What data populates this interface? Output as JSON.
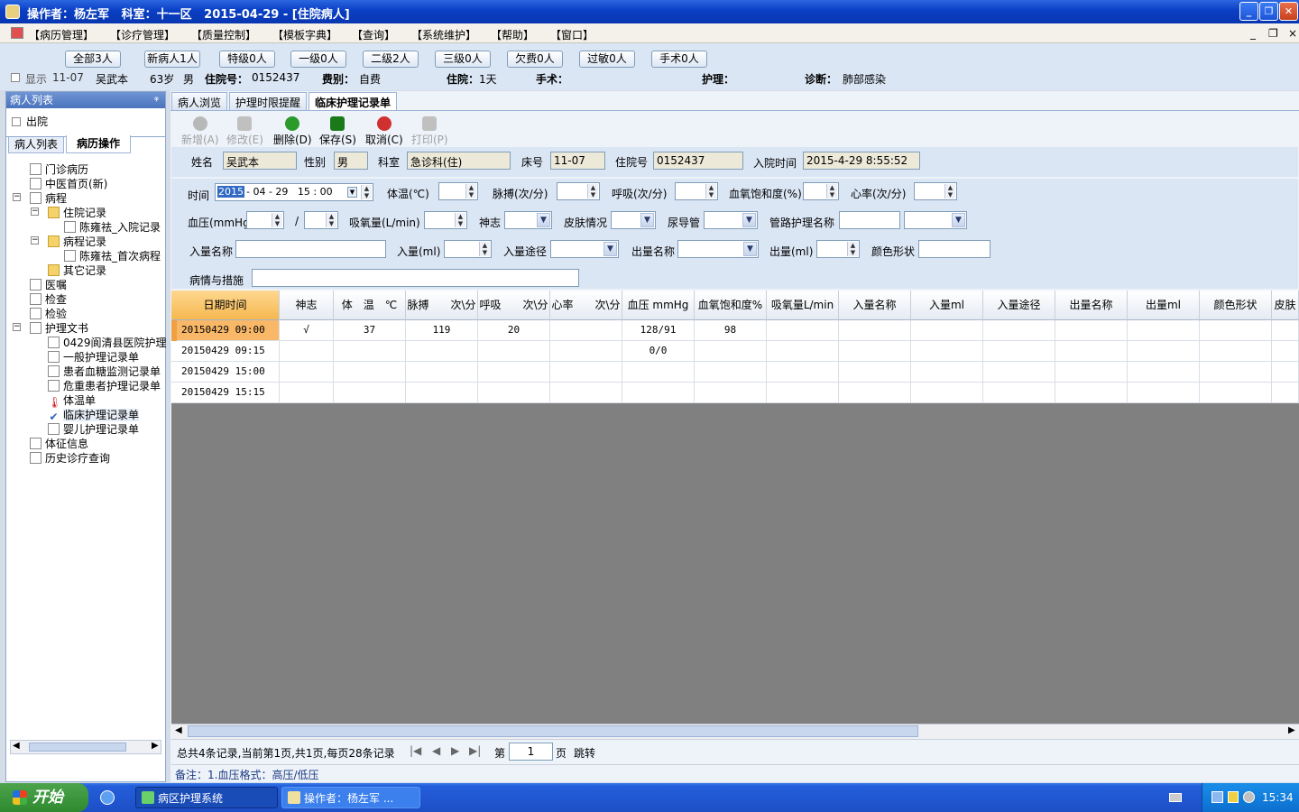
{
  "window": {
    "title": "操作者：杨左军   科室：十一区   2015-04-29 - [住院病人]",
    "btn_min": "_",
    "btn_max": "❐",
    "btn_close": "✕"
  },
  "menubar": {
    "items": [
      "【病历管理】",
      "【诊疗管理】",
      "【质量控制】",
      "【模板字典】",
      "【查询】",
      "【系统维护】",
      "【帮助】",
      "【窗口】"
    ],
    "right_controls": [
      "_",
      "❐",
      "×"
    ]
  },
  "filters": [
    "全部3人",
    "新病人1人",
    "特级0人",
    "一级0人",
    "二级2人",
    "三级0人",
    "欠费0人",
    "过敏0人",
    "手术0人"
  ],
  "patient_bar": {
    "show_label": "显示",
    "bed": "11-07",
    "name": "吴武本",
    "age": "63岁",
    "sex": "男",
    "admission_no_label": "住院号：",
    "admission_no": "0152437",
    "fee_label": "费别：",
    "fee": "自费",
    "stay_label": "住院：",
    "stay": "1天",
    "surgery_label": "手术：",
    "nursing_label": "护理：",
    "diagnosis_label": "诊断：",
    "diagnosis": "肺部感染"
  },
  "left_panel": {
    "header": "病人列表",
    "pin": "ᵠ",
    "discharged_label": "出院",
    "tabs": [
      "病人列表",
      "病历操作"
    ],
    "tree": [
      {
        "label": "门诊病历",
        "depth": 1,
        "icon": "document-icon"
      },
      {
        "label": "中医首页(新)",
        "depth": 1,
        "icon": "document-icon"
      },
      {
        "label": "病程",
        "depth": 1,
        "icon": "document-icon"
      },
      {
        "label": "住院记录",
        "depth": 2,
        "icon": "folder-icon"
      },
      {
        "label": "陈雍祛_入院记录",
        "depth": 3,
        "icon": "document-icon"
      },
      {
        "label": "病程记录",
        "depth": 2,
        "icon": "folder-icon"
      },
      {
        "label": "陈雍祛_首次病程",
        "depth": 3,
        "icon": "document-icon"
      },
      {
        "label": "其它记录",
        "depth": 2,
        "icon": "folder-icon"
      },
      {
        "label": "医嘱",
        "depth": 1,
        "icon": "document-icon"
      },
      {
        "label": "检查",
        "depth": 1,
        "icon": "document-icon"
      },
      {
        "label": "检验",
        "depth": 1,
        "icon": "document-icon"
      },
      {
        "label": "护理文书",
        "depth": 1,
        "icon": "document-icon"
      },
      {
        "label": "0429阆清县医院护理",
        "depth": 2,
        "icon": "document-icon"
      },
      {
        "label": "一般护理记录单",
        "depth": 2,
        "icon": "document-icon"
      },
      {
        "label": "患者血糖监测记录单",
        "depth": 2,
        "icon": "document-icon"
      },
      {
        "label": "危重患者护理记录单",
        "depth": 2,
        "icon": "document-icon"
      },
      {
        "label": "体温单",
        "depth": 2,
        "icon": "thermometer-icon"
      },
      {
        "label": "临床护理记录单",
        "depth": 2,
        "icon": "check-icon"
      },
      {
        "label": "婴儿护理记录单",
        "depth": 2,
        "icon": "document-icon"
      },
      {
        "label": "体征信息",
        "depth": 1,
        "icon": "document-icon"
      },
      {
        "label": "历史诊疗查询",
        "depth": 1,
        "icon": "document-icon"
      }
    ]
  },
  "main_tabs": [
    "病人浏览",
    "护理时限提醒",
    "临床护理记录单"
  ],
  "toolbar": {
    "add": "新增(A)",
    "edit": "修改(E)",
    "delete": "删除(D)",
    "save": "保存(S)",
    "cancel": "取消(C)",
    "print": "打印(P)"
  },
  "info": {
    "name_label": "姓名",
    "name": "吴武本",
    "sex_label": "性别",
    "sex": "男",
    "dept_label": "科室",
    "dept": "急诊科(住)",
    "bed_label": "床号",
    "bed": "11-07",
    "admno_label": "住院号",
    "admno": "0152437",
    "admtime_label": "入院时间",
    "admtime": "2015-4-29 8:55:52"
  },
  "form": {
    "time_label": "时间",
    "time_year": "2015",
    "time_rest": "- 04 - 29   15 : 00",
    "temp_label": "体温(℃)",
    "pulse_label": "脉搏(次/分)",
    "resp_label": "呼吸(次/分)",
    "spo2_label": "血氧饱和度(%)",
    "hr_label": "心率(次/分)",
    "bp_label": "血压(mmHg)",
    "slash": "/",
    "oxygen_label": "吸氧量(L/min)",
    "mind_label": "神志",
    "skin_label": "皮肤情况",
    "catheter_label": "尿导管",
    "tube_label": "管路护理名称",
    "intake_name_label": "入量名称",
    "intake_label": "入量(ml)",
    "intake_route_label": "入量途径",
    "output_name_label": "出量名称",
    "output_label": "出量(ml)",
    "color_label": "颜色形状",
    "condition_label": "病情与措施"
  },
  "grid": {
    "columns": [
      "日期时间",
      "神志",
      "体　温　℃",
      "脉搏　　次\\分",
      "呼吸　　次\\分",
      "心率　　次\\分",
      "血压 mmHg",
      "血氧饱和度%",
      "吸氧量L/min",
      "入量名称",
      "入量ml",
      "入量途径",
      "出量名称",
      "出量ml",
      "颜色形状",
      "皮肤"
    ],
    "rows": [
      [
        "20150429 09:00",
        "√",
        "37",
        "119",
        "20",
        "",
        "128/91",
        "98",
        "",
        "",
        "",
        "",
        "",
        "",
        "",
        ""
      ],
      [
        "20150429 09:15",
        "",
        "",
        "",
        "",
        "",
        "0/0",
        "",
        "",
        "",
        "",
        "",
        "",
        "",
        "",
        ""
      ],
      [
        "20150429 15:00",
        "",
        "",
        "",
        "",
        "",
        "",
        "",
        "",
        "",
        "",
        "",
        "",
        "",
        "",
        ""
      ],
      [
        "20150429 15:15",
        "",
        "",
        "",
        "",
        "",
        "",
        "",
        "",
        "",
        "",
        "",
        "",
        "",
        "",
        ""
      ]
    ]
  },
  "pager": {
    "summary": "总共4条记录,当前第1页,共1页,每页28条记录",
    "page_prefix": "第",
    "page": "1",
    "page_suffix": "页",
    "jump": "跳转"
  },
  "remark": "备注：1.血压格式：高压/低压",
  "taskbar": {
    "start": "开始",
    "tasks": [
      "病区护理系统",
      "操作者：杨左军 ..."
    ],
    "clock": "15:34"
  }
}
